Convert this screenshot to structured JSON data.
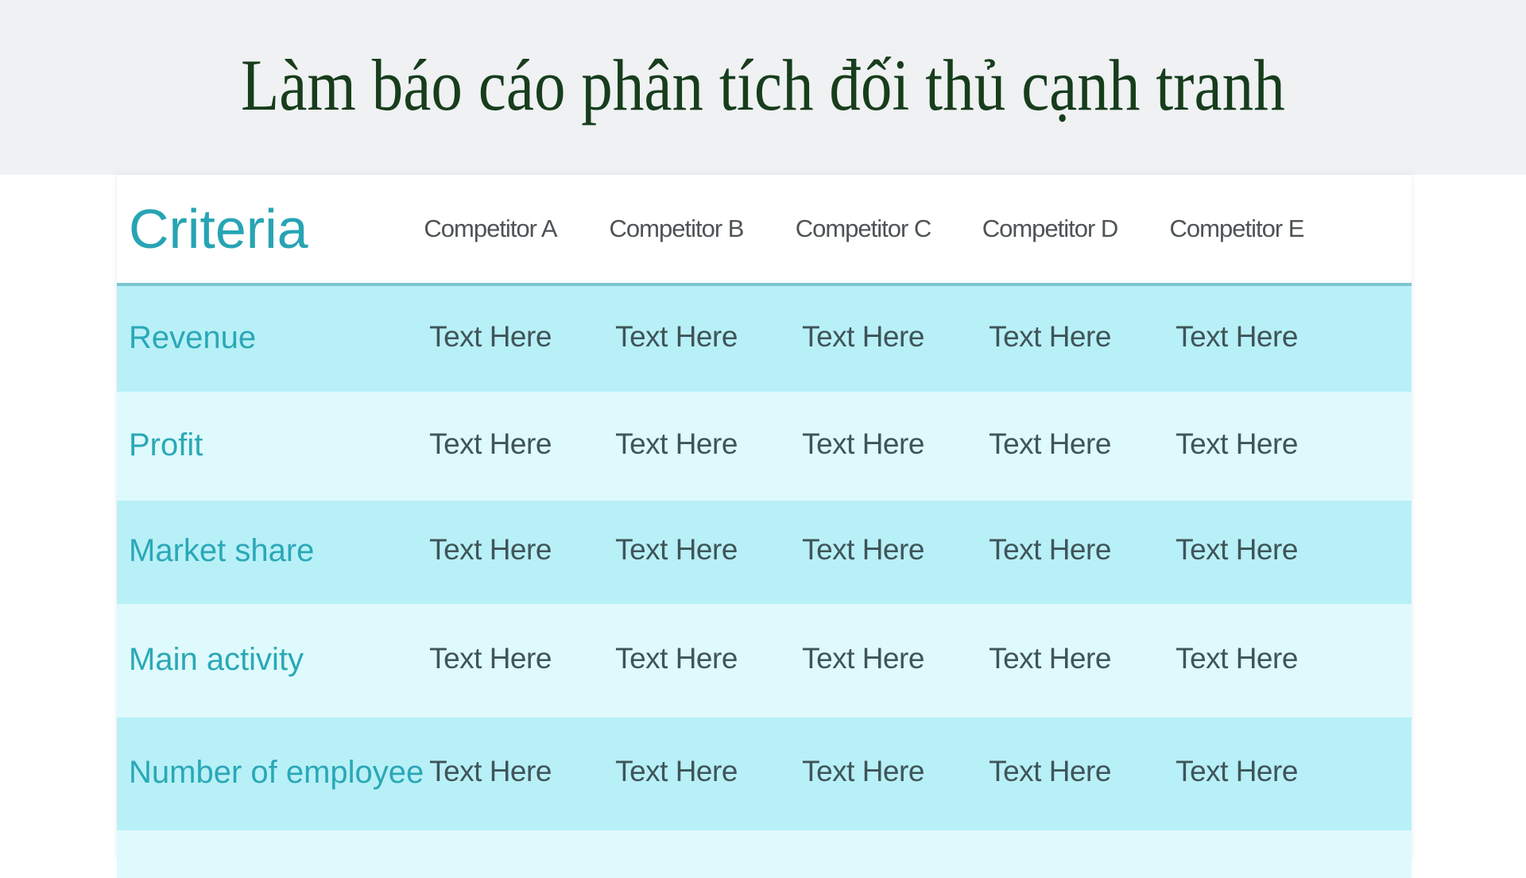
{
  "title": "Làm báo cáo phân tích đối thủ cạnh tranh",
  "table": {
    "header_label": "Criteria",
    "competitors": [
      "Competitor A",
      "Competitor B",
      "Competitor C",
      "Competitor D",
      "Competitor E"
    ],
    "rows": [
      {
        "label": "Revenue",
        "cells": [
          "Text Here",
          "Text Here",
          "Text Here",
          "Text Here",
          "Text Here"
        ]
      },
      {
        "label": "Profit",
        "cells": [
          "Text Here",
          "Text Here",
          "Text Here",
          "Text Here",
          "Text Here"
        ]
      },
      {
        "label": "Market share",
        "cells": [
          "Text Here",
          "Text Here",
          "Text Here",
          "Text Here",
          "Text Here"
        ]
      },
      {
        "label": "Main activity",
        "cells": [
          "Text Here",
          "Text Here",
          "Text Here",
          "Text Here",
          "Text Here"
        ]
      },
      {
        "label": "Number of employee",
        "cells": [
          "Text Here",
          "Text Here",
          "Text Here",
          "Text Here",
          "Text Here"
        ]
      }
    ]
  },
  "colors": {
    "title": "#173d1c",
    "accent": "#27a4b4",
    "row_dark": "#b8f0f7",
    "row_light": "#dffafc"
  }
}
